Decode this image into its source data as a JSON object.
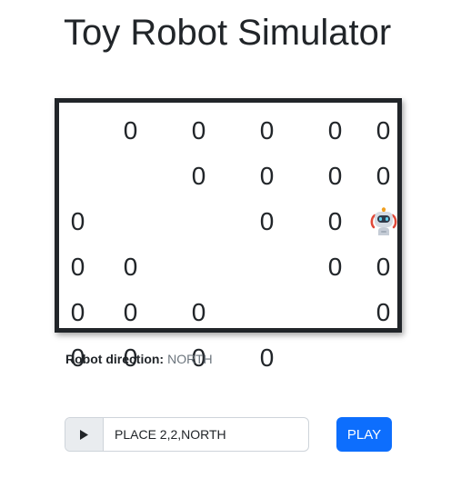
{
  "page": {
    "title": "Toy Robot Simulator"
  },
  "board": {
    "size": 5,
    "empty_value": "0",
    "robot": {
      "row": 2,
      "col": 2,
      "icon": "robot-icon"
    },
    "rows": [
      [
        "0",
        "0",
        "0",
        "0",
        "0"
      ],
      [
        "0",
        "0",
        "0",
        "0",
        "0"
      ],
      [
        "0",
        "0",
        "",
        "0",
        "0"
      ],
      [
        "0",
        "0",
        "0",
        "0",
        "0"
      ],
      [
        "0",
        "0",
        "0",
        "0",
        "0"
      ]
    ]
  },
  "status": {
    "direction_label": "Robot direction:",
    "direction_value": "NORTH"
  },
  "command": {
    "icon": "play-icon",
    "value": "PLACE 2,2,NORTH"
  },
  "play_button": {
    "label": "PLAY"
  },
  "colors": {
    "text": "#212529",
    "muted": "#6c757d",
    "primary": "#0d6efd",
    "border": "#ced4da",
    "addon_bg": "#e9ecef"
  }
}
